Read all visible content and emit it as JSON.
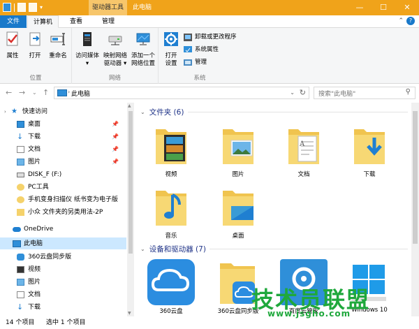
{
  "window": {
    "title": "此电脑",
    "tools_tab": "驱动器工具",
    "min": "—",
    "max": "☐",
    "close": "✕"
  },
  "tabs": {
    "file": "文件",
    "computer": "计算机",
    "view": "查看",
    "manage": "管理"
  },
  "ribbon": {
    "location": {
      "name": "位置",
      "properties": "属性",
      "open": "打开",
      "rename": "重命名"
    },
    "network": {
      "name": "网络",
      "access_media": "访问媒体",
      "map_drive_1": "映射网络",
      "map_drive_2": "驱动器",
      "add_location_1": "添加一个",
      "add_location_2": "网络位置"
    },
    "system": {
      "name": "系统",
      "open_settings_1": "打开",
      "open_settings_2": "设置",
      "uninstall": "卸载或更改程序",
      "sysprops": "系统属性",
      "manage": "管理"
    }
  },
  "address": {
    "crumb": "此电脑",
    "search_placeholder": "搜索\"此电脑\""
  },
  "nav": {
    "quick_access": "快速访问",
    "desktop": "桌面",
    "downloads": "下载",
    "documents": "文档",
    "pictures": "图片",
    "disk_f": "DISK_F (F:)",
    "pc_tools": "PC工具",
    "scanner": "手机变身扫描仪 纸书变为电子版",
    "xiaozhong": "小众 文件夹的另类用法-2P",
    "onedrive": "OneDrive",
    "this_pc": "此电脑",
    "sync_360": "360云盘同步版",
    "videos": "视频",
    "pictures2": "图片",
    "documents2": "文档",
    "downloads2": "下载"
  },
  "content": {
    "folders_header": "文件夹 (6)",
    "devices_header": "设备和驱动器 (7)",
    "folders": [
      "视频",
      "图片",
      "文档",
      "下载",
      "音乐",
      "桌面"
    ],
    "devices": [
      "360云盘",
      "360云盘同步版",
      "百度云管家",
      "Windows 10"
    ]
  },
  "status": {
    "count": "14 个项目",
    "selected": "选中 1 个项目"
  },
  "watermark": {
    "main": "技术员联盟",
    "url": "www.jsgho.com"
  }
}
